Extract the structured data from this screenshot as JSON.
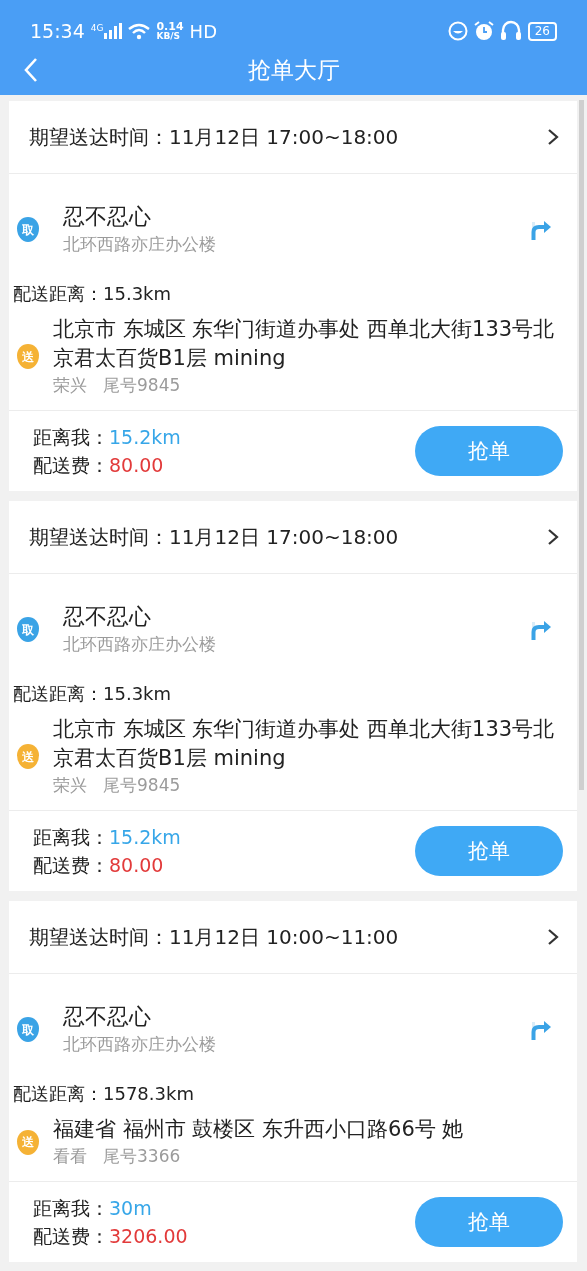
{
  "status_bar": {
    "time": "15:34",
    "network": "4G",
    "speed_value": "0.14",
    "speed_unit": "KB/S",
    "hd": "HD",
    "battery": "26"
  },
  "header": {
    "title": "抢单大厅"
  },
  "orders": [
    {
      "deliver_time_label": "期望送达时间：",
      "deliver_time": "11月12日 17:00~18:00",
      "pickup_tag": "取",
      "pickup_name": "忍不忍心",
      "pickup_address": "北环西路亦庄办公楼",
      "distance_label": "配送距离：",
      "distance": "15.3km",
      "delivery_tag": "送",
      "delivery_address": "北京市 东城区 东华门街道办事处 西单北大街133号北京君太百货B1层 mining",
      "receiver": "荣兴",
      "phone_tail": "尾号9845",
      "from_me_label": "距离我：",
      "from_me": "15.2km",
      "fee_label": "配送费：",
      "fee": "80.00",
      "button": "抢单"
    },
    {
      "deliver_time_label": "期望送达时间：",
      "deliver_time": "11月12日 17:00~18:00",
      "pickup_tag": "取",
      "pickup_name": "忍不忍心",
      "pickup_address": "北环西路亦庄办公楼",
      "distance_label": "配送距离：",
      "distance": "15.3km",
      "delivery_tag": "送",
      "delivery_address": "北京市 东城区 东华门街道办事处 西单北大街133号北京君太百货B1层 mining",
      "receiver": "荣兴",
      "phone_tail": "尾号9845",
      "from_me_label": "距离我：",
      "from_me": "15.2km",
      "fee_label": "配送费：",
      "fee": "80.00",
      "button": "抢单"
    },
    {
      "deliver_time_label": "期望送达时间：",
      "deliver_time": "11月12日 10:00~11:00",
      "pickup_tag": "取",
      "pickup_name": "忍不忍心",
      "pickup_address": "北环西路亦庄办公楼",
      "distance_label": "配送距离：",
      "distance": "1578.3km",
      "delivery_tag": "送",
      "delivery_address": "福建省 福州市 鼓楼区 东升西小口路66号 她",
      "receiver": "看看",
      "phone_tail": "尾号3366",
      "from_me_label": "距离我：",
      "from_me": "30m",
      "fee_label": "配送费：",
      "fee": "3206.00",
      "button": "抢单"
    }
  ]
}
